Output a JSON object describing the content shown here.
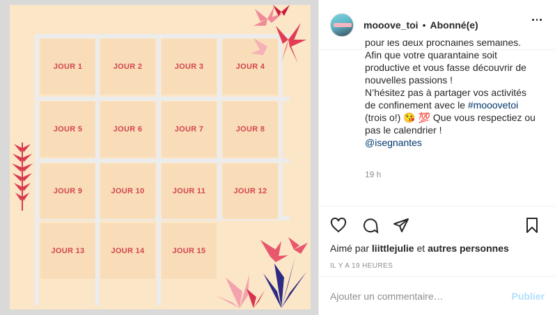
{
  "post_image": {
    "days": [
      "JOUR 1",
      "JOUR 2",
      "JOUR 3",
      "JOUR 4",
      "JOUR 5",
      "JOUR 6",
      "JOUR 7",
      "JOUR 8",
      "JOUR 9",
      "JOUR 10",
      "JOUR 11",
      "JOUR 12",
      "JOUR 13",
      "JOUR 14",
      "JOUR 15"
    ],
    "colors": {
      "background": "#fbe6c8",
      "cell": "#f9ddb8",
      "label": "#d2454f",
      "grid": "#ececec"
    }
  },
  "header": {
    "username": "mooove_toi",
    "separator": "•",
    "follow_status": "Abonné(e)",
    "more_icon": "more-options-icon"
  },
  "caption": {
    "cut_line": "pour les deux prochaines semaines.",
    "line_1": "Afin que votre quarantaine soit",
    "line_2": "productive et vous fasse découvrir de",
    "line_3": "nouvelles passions !",
    "line_4": "N’hésitez pas à partager vos activités",
    "line_5_prefix": "de confinement avec le ",
    "hashtag": "#mooovetoi",
    "line_6_prefix": "(trois o!) ",
    "emojis": "😘 💯",
    "line_6_suffix": " Que vous respectiez ou",
    "line_7": "pas le calendrier !",
    "mention": "@isegnantes",
    "time_ago": "19 h"
  },
  "actions": {
    "icons": [
      "heart-icon",
      "comment-icon",
      "share-icon",
      "bookmark-icon"
    ],
    "liked_by_prefix": "Aimé par ",
    "liked_by_user": "liittlejulie",
    "liked_by_and": " et ",
    "liked_by_others": "autres personnes",
    "posted_ago": "IL Y A 19 HEURES"
  },
  "comment": {
    "placeholder": "Ajouter un commentaire…",
    "publish_label": "Publier"
  }
}
